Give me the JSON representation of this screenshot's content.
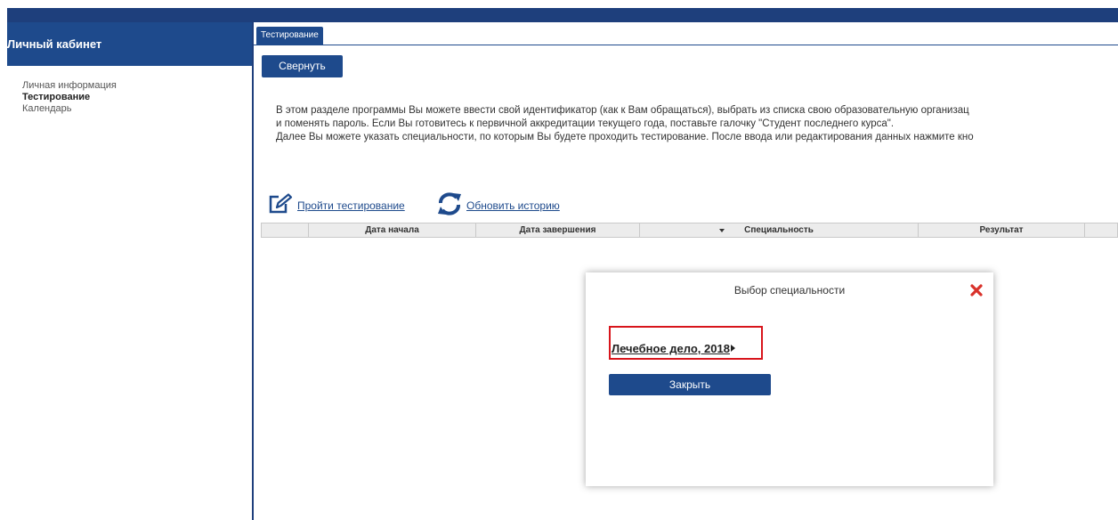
{
  "sidebar": {
    "title": "Личный кабинет",
    "items": [
      {
        "label": "Личная информация",
        "active": false
      },
      {
        "label": "Тестирование",
        "active": true
      },
      {
        "label": "Календарь",
        "active": false
      }
    ]
  },
  "tab": {
    "label": "Тестирование"
  },
  "main": {
    "collapse_button": "Свернуть",
    "description": [
      "В этом разделе программы Вы можете ввести свой идентификатор (как к Вам обращаться), выбрать из списка свою образовательную организац",
      "и поменять пароль. Если Вы готовитесь к первичной аккредитации текущего года, поставьте галочку \"Студент последнего курса\".",
      "Далее Вы можете указать специальности, по которым Вы будете проходить тестирование. После ввода или редактирования данных нажмите кно"
    ],
    "actions": {
      "take_test": {
        "label": "Пройти тестирование",
        "icon": "edit-icon"
      },
      "refresh_history": {
        "label": "Обновить историю",
        "icon": "refresh-icon"
      }
    },
    "table": {
      "columns": [
        "Дата начала",
        "Дата завершения",
        "Специальность",
        "Результат"
      ],
      "rows": []
    }
  },
  "modal": {
    "title": "Выбор специальности",
    "specialty": "Лечебное дело, 2018",
    "close_button": "Закрыть"
  },
  "colors": {
    "brand_blue": "#1e4a8c",
    "highlight_red": "#d8151c",
    "close_icon_red": "#d9322b"
  }
}
